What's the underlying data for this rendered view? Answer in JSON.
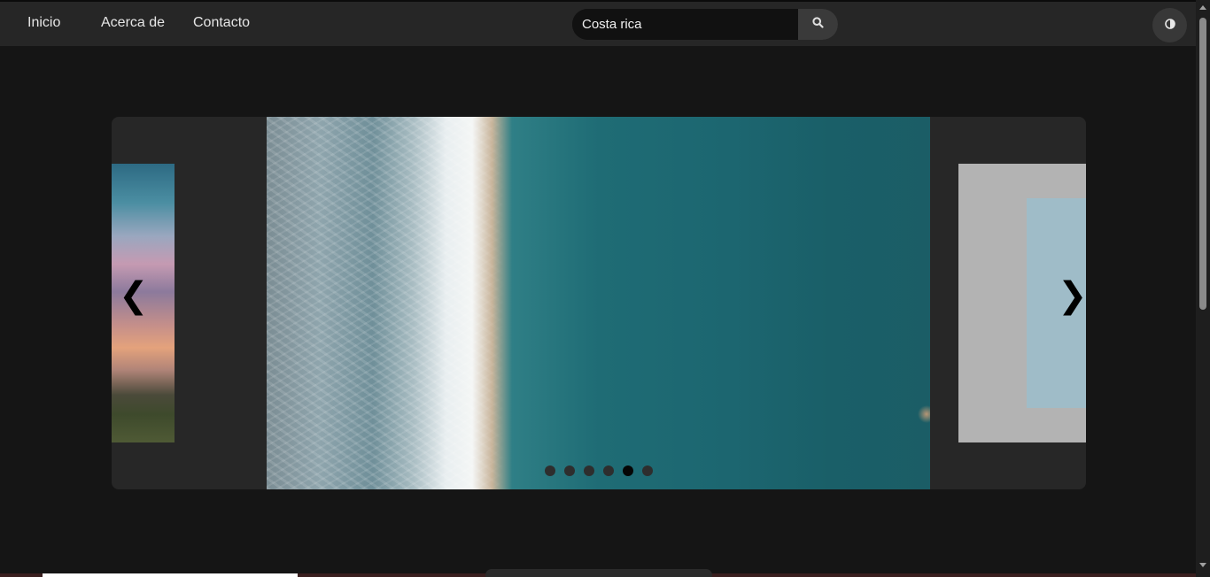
{
  "nav": {
    "links": [
      "Inicio",
      "Acerca de",
      "Contacto"
    ]
  },
  "search": {
    "value": "Costa rica",
    "icon": "search-icon"
  },
  "theme_toggle": {
    "icon": "contrast-icon"
  },
  "carousel": {
    "prev_arrow": "❮",
    "next_arrow": "❯",
    "dot_count": 6,
    "active_dot": 5,
    "slides": {
      "previous": "sunset landscape",
      "current": "aerial ocean shoreline",
      "next": "light blue panel"
    }
  },
  "colors": {
    "background": "#151515",
    "navbar": "#262626",
    "carousel": "#272727",
    "dot": "#2e2e2e",
    "dot_active": "#050505"
  }
}
